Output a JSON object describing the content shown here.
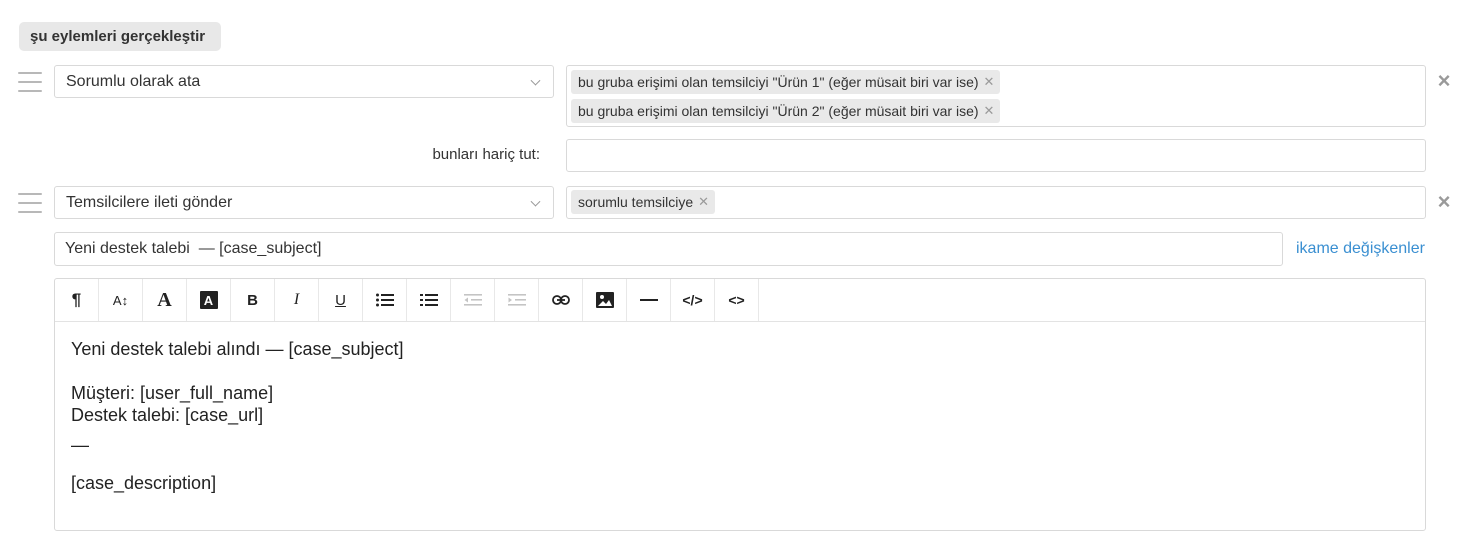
{
  "section": {
    "label": "şu eylemleri gerçekleştir"
  },
  "action1": {
    "select_value": "Sorumlu olarak ata",
    "tags": [
      "bu gruba erişimi olan temsilciyi \"Ürün 1\" (eğer müsait biri var ise)",
      "bu gruba erişimi olan temsilciyi \"Ürün 2\" (eğer müsait biri var ise)"
    ],
    "exclude_label": "bunları hariç tut:",
    "exclude_value": "",
    "remove_icon": "close-icon"
  },
  "action2": {
    "select_value": "Temsilcilere ileti gönder",
    "tags": [
      "sorumlu temsilciye"
    ],
    "subject_value": "Yeni destek talebi  — [case_subject]",
    "variables_link": "ikame değişkenler",
    "remove_icon": "close-icon"
  },
  "toolbar": {
    "buttons": [
      {
        "name": "paragraph-icon",
        "glyph": "¶"
      },
      {
        "name": "font-size-icon",
        "glyph": "A↕"
      },
      {
        "name": "font-color-icon",
        "glyph": "A"
      },
      {
        "name": "background-color-icon",
        "glyph": "A"
      },
      {
        "name": "bold-icon",
        "glyph": "B"
      },
      {
        "name": "italic-icon",
        "glyph": "I"
      },
      {
        "name": "underline-icon",
        "glyph": "U"
      },
      {
        "name": "bullet-list-icon",
        "glyph": "≔"
      },
      {
        "name": "numbered-list-icon",
        "glyph": "≔"
      },
      {
        "name": "outdent-icon",
        "glyph": "⇤"
      },
      {
        "name": "indent-icon",
        "glyph": "⇥"
      },
      {
        "name": "link-icon",
        "glyph": "⛓"
      },
      {
        "name": "image-icon",
        "glyph": "▣"
      },
      {
        "name": "horizontal-rule-icon",
        "glyph": "—"
      },
      {
        "name": "code-view-icon",
        "glyph": "</>"
      },
      {
        "name": "embed-icon",
        "glyph": "<>"
      }
    ]
  },
  "body": {
    "line1": "Yeni destek talebi alındı — [case_subject]",
    "line2": "Müşteri: [user_full_name]",
    "line3": "Destek talebi: [case_url]",
    "line4": "—",
    "line5": "[case_description]"
  },
  "colors": {
    "accent": "#3a8fd1",
    "border": "#d9d9d9",
    "tag_bg": "#e9e9e9"
  }
}
